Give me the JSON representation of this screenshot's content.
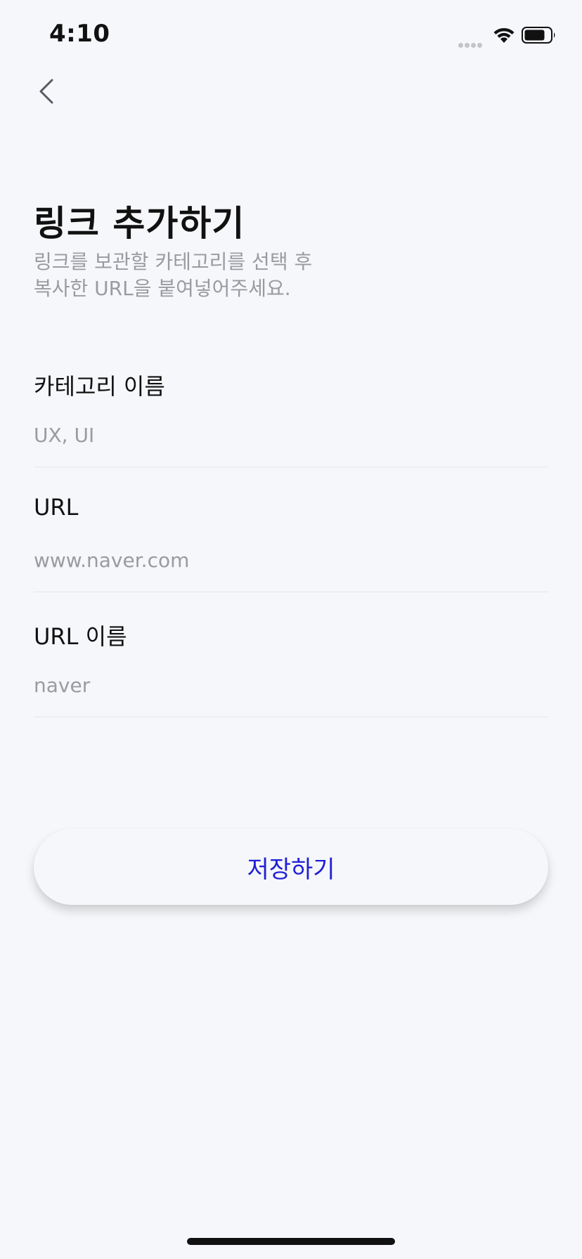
{
  "status_bar": {
    "time": "4:10",
    "icons": [
      "signal-icon",
      "wifi-icon",
      "battery-icon"
    ]
  },
  "header": {
    "back_icon": "chevron-left-icon",
    "title": "링크 추가하기",
    "subtitle_line1": "링크를 보관할 카테고리를 선택 후",
    "subtitle_line2": "복사한 URL을 붙여넣어주세요."
  },
  "form": {
    "category": {
      "label": "카테고리 이름",
      "placeholder": "UX, UI"
    },
    "url": {
      "label": "URL",
      "placeholder": "www.naver.com"
    },
    "url_name": {
      "label": "URL 이름",
      "placeholder": "naver"
    }
  },
  "actions": {
    "save_label": "저장하기"
  },
  "colors": {
    "background": "#f6f7fa",
    "accent": "#1f1fd8",
    "placeholder": "#9a9aa0",
    "divider": "#e6e7eb"
  }
}
